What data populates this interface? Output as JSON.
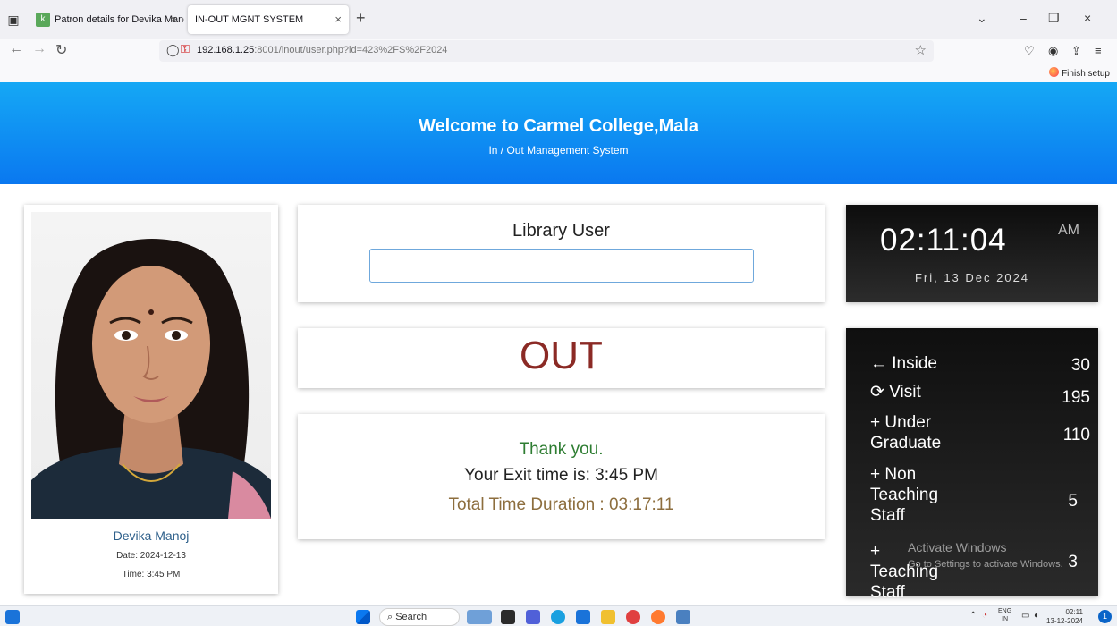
{
  "browser": {
    "tabs": [
      {
        "label": "Patron details for Devika Manoj",
        "active": false
      },
      {
        "label": "IN-OUT MGNT SYSTEM",
        "active": true
      }
    ],
    "url_host": "192.168.1.25",
    "url_rest": ":8001/inout/user.php?id=423%2FS%2F2024",
    "finish_setup": "Finish setup"
  },
  "header": {
    "title": "Welcome to Carmel College,Mala",
    "subtitle": "In / Out Management System",
    "colors": {
      "top": "#15a8f5",
      "bottom": "#0a78f0"
    }
  },
  "profile": {
    "name": "Devika Manoj",
    "date": "Date: 2024-12-13",
    "time": "Time: 3:45 PM"
  },
  "user_entry": {
    "label": "Library User",
    "input_value": "",
    "input_placeholder": ""
  },
  "status": {
    "text": "OUT",
    "color": "#8b2a25"
  },
  "message": {
    "line1": "Thank you.",
    "line2": "Your Exit time is: 3:45 PM",
    "line3": "Total Time Duration : 03:17:11"
  },
  "clock": {
    "time": "02:11:04",
    "ampm": "AM",
    "date": "Fri, 13 Dec 2024"
  },
  "stats": {
    "items": [
      {
        "icon": "arrow-left-icon",
        "label": "← Inside",
        "value": "30"
      },
      {
        "icon": "refresh-icon",
        "label": "⟳ Visit",
        "value": "195"
      },
      {
        "icon": "plus-icon",
        "label": "+ Under Graduate",
        "value": "110"
      },
      {
        "icon": "plus-icon",
        "label": "+ Non Teaching Staff",
        "value": "5"
      },
      {
        "icon": "plus-icon",
        "label": "+ Teaching Staff",
        "value": "3"
      }
    ]
  },
  "watermark": {
    "line1": "Activate Windows",
    "line2": "Go to Settings to activate Windows."
  },
  "taskbar": {
    "search_label": "Search",
    "lang_top": "ENG",
    "lang_bottom": "IN",
    "time": "02:11",
    "date": "13-12-2024",
    "notification_count": "1"
  }
}
